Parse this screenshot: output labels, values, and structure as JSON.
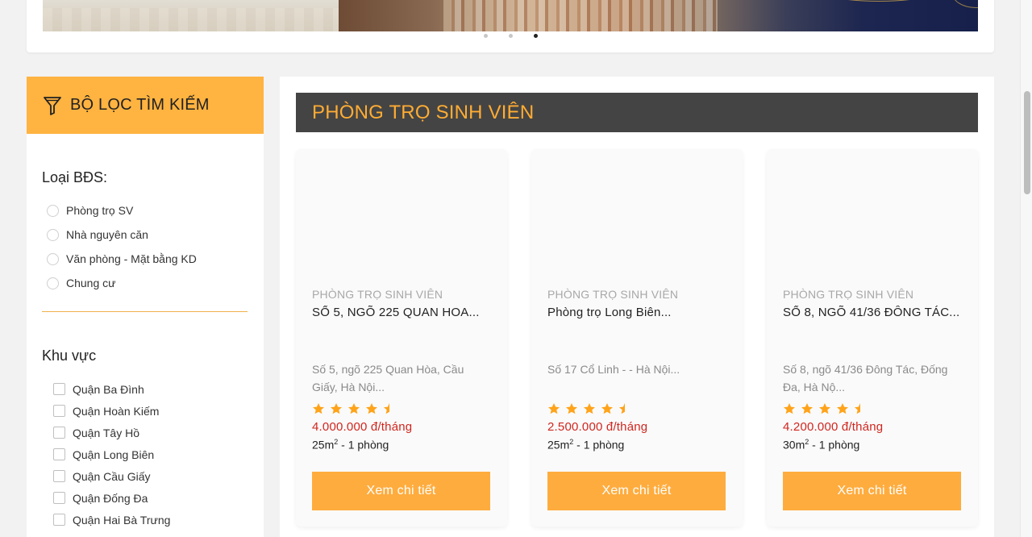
{
  "banner": {
    "slides": [
      {
        "active": false
      },
      {
        "active": false
      },
      {
        "active": true
      }
    ]
  },
  "sidebar": {
    "title": "BỘ LỌC TÌM KIẾM",
    "icon": "filter-icon",
    "property_type": {
      "title": "Loại BĐS:",
      "options": [
        "Phòng trọ SV",
        "Nhà nguyên căn",
        "Văn phòng - Mặt bằng KD",
        "Chung cư"
      ]
    },
    "area": {
      "title": "Khu vực",
      "options": [
        "Quận Ba Đình",
        "Quận Hoàn Kiếm",
        "Quận Tây Hồ",
        "Quận Long Biên",
        "Quận Cầu Giấy",
        "Quận Đống Đa",
        "Quận Hai Bà Trưng"
      ]
    }
  },
  "main": {
    "section_title": "PHÒNG TRỌ SINH VIÊN",
    "colors": {
      "accent": "#ffac3e",
      "bar": "#444444",
      "price": "#d0261f"
    },
    "listings": [
      {
        "category": "PHÒNG TRỌ SINH VIÊN",
        "title": "SỐ 5, NGÕ 225 QUAN HOA...",
        "address": "Số 5, ngõ 225 Quan Hòa, Cầu Giấy, Hà Nội...",
        "rating": 4.5,
        "price": "4.000.000 đ/tháng",
        "area_value": "25m",
        "area_sup": "2",
        "area_rest": " - 1 phòng",
        "button": "Xem chi tiết"
      },
      {
        "category": "PHÒNG TRỌ SINH VIÊN",
        "title": "Phòng trọ Long Biên...",
        "address": "Số 17 Cổ Linh - - Hà Nội...",
        "rating": 4.5,
        "price": "2.500.000 đ/tháng",
        "area_value": "25m",
        "area_sup": "2",
        "area_rest": " - 1 phòng",
        "button": "Xem chi tiết"
      },
      {
        "category": "PHÒNG TRỌ SINH VIÊN",
        "title": "SỐ 8, NGÕ 41/36 ĐÔNG TÁC...",
        "address": "Số 8, ngõ 41/36 Đông Tác, Đống Đa, Hà Nộ...",
        "rating": 4.5,
        "price": "4.200.000 đ/tháng",
        "area_value": "30m",
        "area_sup": "2",
        "area_rest": " - 1 phòng",
        "button": "Xem chi tiết"
      }
    ]
  }
}
